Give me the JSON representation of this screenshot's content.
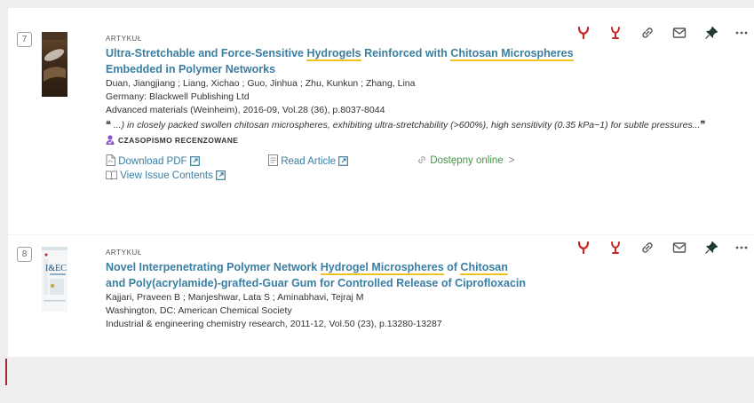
{
  "results": [
    {
      "rank": "7",
      "type": "ARTYKUŁ",
      "title_parts": [
        {
          "text": "Ultra-Stretchable and Force-Sensitive ",
          "hl": false
        },
        {
          "text": "Hydrogels",
          "hl": true
        },
        {
          "text": " Reinforced with ",
          "hl": false
        },
        {
          "text": "Chitosan Microspheres",
          "hl": true
        },
        {
          "text": " Embedded in Polymer Networks",
          "hl": false
        }
      ],
      "authors": "Duan, Jiangjiang ; Liang, Xichao ; Guo, Jinhua ; Zhu, Kunkun ; Zhang, Lina",
      "publisher": "Germany: Blackwell Publishing Ltd",
      "source": "Advanced materials (Weinheim), 2016-09, Vol.28 (36), p.8037-8044",
      "snippet_open": "❝",
      "snippet": " ...) in closely packed swollen chitosan microspheres, exhibiting ultra-stretchability (>600%), high sensitivity (0.35 kPa−1) for subtle pressures...",
      "snippet_close": "❞",
      "peer_reviewed": "CZASOPISMO RECENZOWANE",
      "download_pdf": "Download PDF",
      "read_article": "Read Article",
      "available": "Dostępny online",
      "available_arrow": ">",
      "view_issue": "View Issue Contents"
    },
    {
      "rank": "8",
      "type": "ARTYKUŁ",
      "title_parts": [
        {
          "text": "Novel Interpenetrating Polymer Network ",
          "hl": false
        },
        {
          "text": "Hydrogel Microspheres",
          "hl": true
        },
        {
          "text": " of ",
          "hl": false
        },
        {
          "text": "Chitosan",
          "hl": true
        },
        {
          "text": " and Poly(acrylamide)-grafted-Guar Gum for Controlled Release of Ciprofloxacin",
          "hl": false
        }
      ],
      "authors": "Kajjari, Praveen B ; Manjeshwar, Lata S ; Aminabhavi, Tejraj M",
      "publisher": "Washington, DC: American Chemical Society",
      "source": "Industrial & engineering chemistry research, 2011-12, Vol.50 (23), p.13280-13287",
      "cover_text": "I&EC"
    }
  ],
  "action_icons": [
    "citation-trail-icon",
    "cited-by-icon",
    "permalink-icon",
    "email-icon",
    "pin-icon",
    "more-icon"
  ],
  "colors": {
    "accent": "#3a7ea1",
    "action_red": "#c62828",
    "available_green": "#3d9a3d",
    "highlight": "#f0c420",
    "peer_badge": "#8a55c8"
  }
}
